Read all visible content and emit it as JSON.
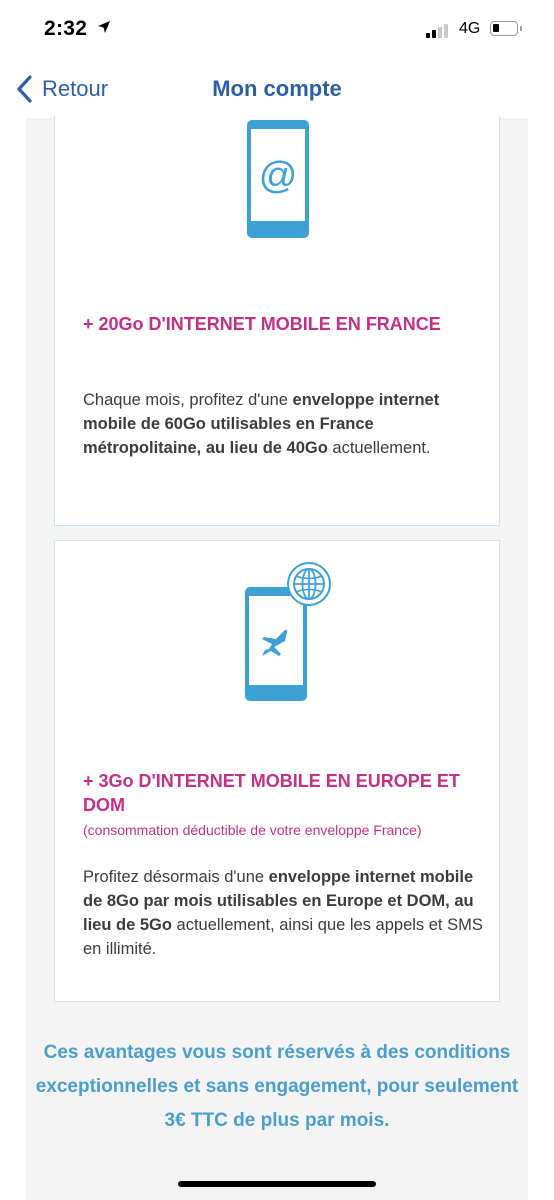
{
  "status_bar": {
    "time": "2:32",
    "network": "4G"
  },
  "nav": {
    "back_label": "Retour",
    "title": "Mon compte"
  },
  "offers": [
    {
      "icon": "phone-at-icon",
      "title": "+ 20Go D'INTERNET MOBILE EN FRANCE",
      "desc_prefix": "Chaque mois, profitez d'une ",
      "desc_bold": "enveloppe internet mobile de 60Go utilisables en France métropolitaine, au lieu de 40Go",
      "desc_suffix": " actuellement."
    },
    {
      "icon": "phone-plane-globe-icon",
      "title": "+ 3Go D'INTERNET MOBILE EN EUROPE ET DOM",
      "note": "(consommation déductible de votre enveloppe France)",
      "desc_prefix": "Profitez désormais d'une ",
      "desc_bold": "enveloppe internet mobile de 8Go par mois utilisables en Europe et DOM, au lieu de 5Go",
      "desc_suffix": " actuellement, ainsi que les appels et SMS en illimité."
    }
  ],
  "footer": {
    "text": "Ces avantages vous sont réservés à des conditions exceptionnelles et sans engagement, pour seulement 3€ TTC de plus par mois."
  },
  "colors": {
    "nav_blue": "#2b5ea7",
    "accent_pink": "#c62f86",
    "icon_blue": "#3ea1d6",
    "footer_blue": "#4a9fd0",
    "card_border": "#cfe3f5"
  }
}
